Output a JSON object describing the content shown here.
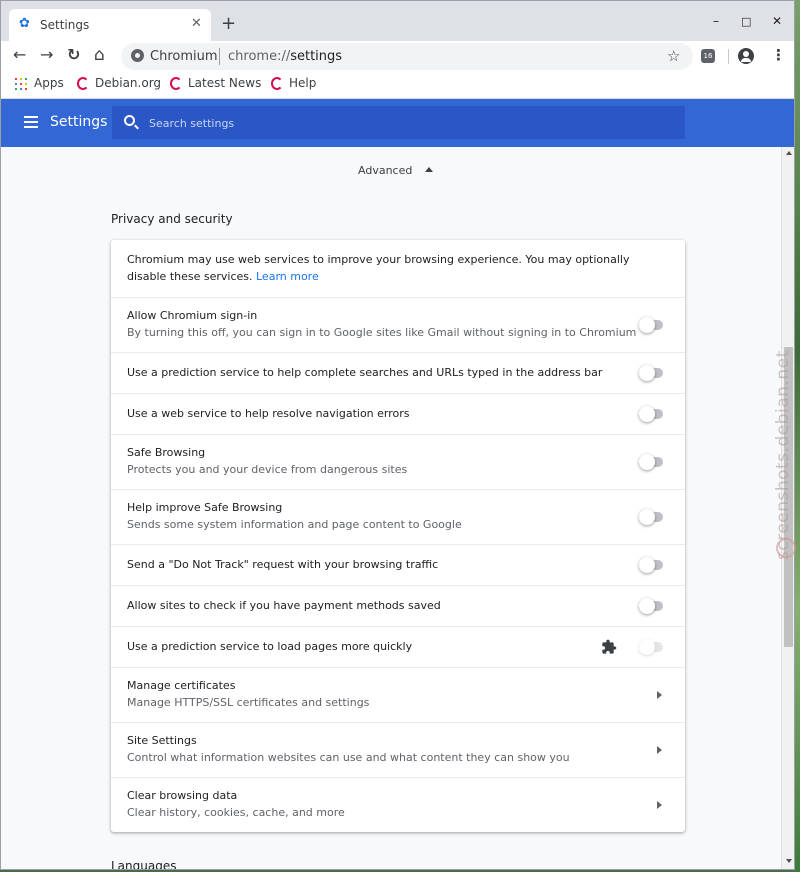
{
  "tab": {
    "title": "Settings",
    "close": "✕",
    "new_tab": "+"
  },
  "window_controls": {
    "minimize": "–",
    "maximize": "□",
    "close": "✕"
  },
  "toolbar": {
    "back": "←",
    "forward": "→",
    "reload": "↻",
    "home": "⌂",
    "site_name": "Chromium",
    "url_scheme": "chrome://",
    "url_path": "settings",
    "star": "☆",
    "extension_badge": "16",
    "menu": "⋮"
  },
  "bookmarks": [
    {
      "label": "Apps",
      "icon": "apps-grid-icon"
    },
    {
      "label": "Debian.org",
      "icon": "debian-swirl-icon"
    },
    {
      "label": "Latest News",
      "icon": "debian-swirl-icon"
    },
    {
      "label": "Help",
      "icon": "debian-swirl-icon"
    }
  ],
  "header": {
    "title": "Settings",
    "search_placeholder": "Search settings",
    "accent_color": "#3367d6"
  },
  "advanced_label": "Advanced",
  "section": {
    "title": "Privacy and security",
    "intro_text": "Chromium may use web services to improve your browsing experience. You may optionally disable these services.",
    "learn_more": "Learn more",
    "rows": [
      {
        "title": "Allow Chromium sign-in",
        "subtitle": "By turning this off, you can sign in to Google sites like Gmail without signing in to Chromium",
        "control": "toggle",
        "on": false
      },
      {
        "title": "Use a prediction service to help complete searches and URLs typed in the address bar",
        "subtitle": "",
        "control": "toggle",
        "on": false
      },
      {
        "title": "Use a web service to help resolve navigation errors",
        "subtitle": "",
        "control": "toggle",
        "on": false
      },
      {
        "title": "Safe Browsing",
        "subtitle": "Protects you and your device from dangerous sites",
        "control": "toggle",
        "on": false
      },
      {
        "title": "Help improve Safe Browsing",
        "subtitle": "Sends some system information and page content to Google",
        "control": "toggle",
        "on": false
      },
      {
        "title": "Send a \"Do Not Track\" request with your browsing traffic",
        "subtitle": "",
        "control": "toggle",
        "on": false
      },
      {
        "title": "Allow sites to check if you have payment methods saved",
        "subtitle": "",
        "control": "toggle",
        "on": false
      },
      {
        "title": "Use a prediction service to load pages more quickly",
        "subtitle": "",
        "control": "toggle-disabled-extension",
        "on": false
      },
      {
        "title": "Manage certificates",
        "subtitle": "Manage HTTPS/SSL certificates and settings",
        "control": "arrow"
      },
      {
        "title": "Site Settings",
        "subtitle": "Control what information websites can use and what content they can show you",
        "control": "arrow"
      },
      {
        "title": "Clear browsing data",
        "subtitle": "Clear history, cookies, cache, and more",
        "control": "arrow"
      }
    ]
  },
  "next_section_title": "Languages",
  "watermark": "screenshots.debian.net"
}
